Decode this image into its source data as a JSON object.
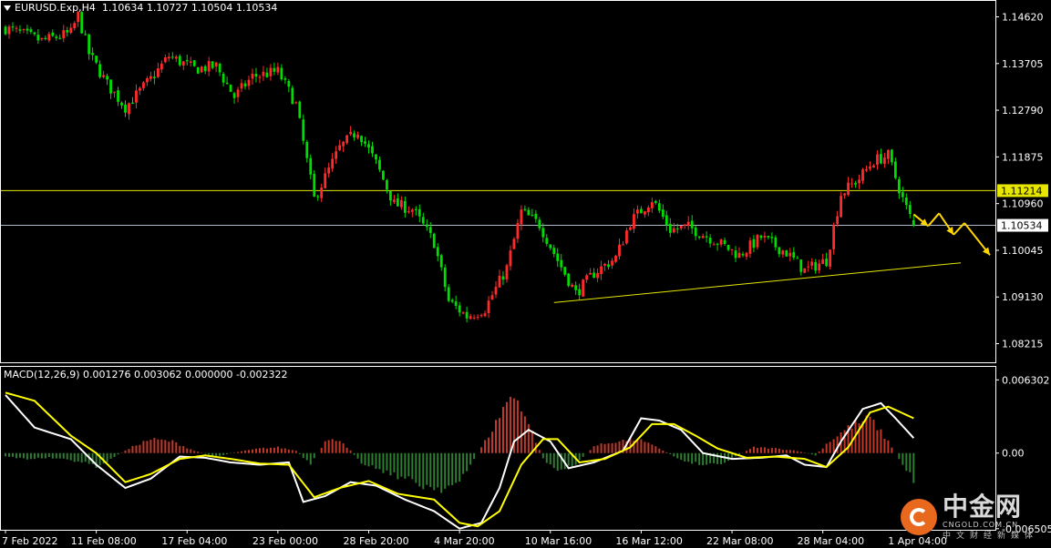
{
  "header": {
    "symbol": "EURUSD.Exp,H4",
    "open": "1.10634",
    "high": "1.10727",
    "low": "1.10504",
    "close": "1.10534"
  },
  "macd_header": {
    "label": "MACD(12,26,9)",
    "values": "0.001276 0.003062 0.000000 -0.002322"
  },
  "watermark": {
    "name": "中金网",
    "domain": "CNGOLD.COM.CN",
    "subtitle": "中文财经新媒体"
  },
  "colors": {
    "bull": "#ff2a2a",
    "bear": "#00dd00",
    "horizontal_line": "#e6e600",
    "current_price_line": "#b0b8c8",
    "trendline": "#e6e600",
    "signal_line": "#ffff00",
    "macd_line": "#ffffff",
    "hist_pos": "#c0392b",
    "hist_neg": "#2e7d32",
    "arrow": "#ffd700",
    "axis": "#ffffff"
  },
  "chart_data": [
    {
      "type": "candlestick",
      "title": "EURUSD.Exp,H4",
      "ylim": [
        1.0785,
        1.1495
      ],
      "y_ticks": [
        "1.14620",
        "1.13705",
        "1.12790",
        "1.11875",
        "1.10960",
        "1.10045",
        "1.09130",
        "1.08215"
      ],
      "price_labels": [
        {
          "value": 1.11214,
          "text": "1.11214",
          "style": "resistance"
        },
        {
          "value": 1.10534,
          "text": "1.10534",
          "style": "current"
        }
      ],
      "x_labels": [
        "7 Feb 2022",
        "11 Feb 08:00",
        "17 Feb 04:00",
        "23 Feb 00:00",
        "28 Feb 20:00",
        "4 Mar 20:00",
        "10 Mar 16:00",
        "16 Mar 12:00",
        "22 Mar 08:00",
        "28 Mar 04:00",
        "1 Apr 04:00"
      ],
      "x_label_index": [
        0,
        25,
        50,
        75,
        100,
        125,
        150,
        175,
        200,
        225,
        250
      ],
      "bar_count": 263,
      "close_path": [
        [
          0,
          1.144
        ],
        [
          10,
          1.1415
        ],
        [
          18,
          1.143
        ],
        [
          20,
          1.1465
        ],
        [
          23,
          1.139
        ],
        [
          28,
          1.133
        ],
        [
          33,
          1.1285
        ],
        [
          40,
          1.134
        ],
        [
          45,
          1.1385
        ],
        [
          52,
          1.136
        ],
        [
          58,
          1.1365
        ],
        [
          63,
          1.1305
        ],
        [
          68,
          1.1345
        ],
        [
          75,
          1.1355
        ],
        [
          80,
          1.129
        ],
        [
          85,
          1.1105
        ],
        [
          92,
          1.1205
        ],
        [
          97,
          1.124
        ],
        [
          102,
          1.1175
        ],
        [
          107,
          1.1095
        ],
        [
          112,
          1.1085
        ],
        [
          118,
          1.102
        ],
        [
          122,
          1.0905
        ],
        [
          127,
          1.0875
        ],
        [
          132,
          1.089
        ],
        [
          138,
          1.097
        ],
        [
          142,
          1.108
        ],
        [
          147,
          1.1055
        ],
        [
          152,
          1.0985
        ],
        [
          157,
          1.092
        ],
        [
          162,
          1.096
        ],
        [
          168,
          1.099
        ],
        [
          172,
          1.106
        ],
        [
          178,
          1.1105
        ],
        [
          183,
          1.1045
        ],
        [
          188,
          1.105
        ],
        [
          195,
          1.1025
        ],
        [
          202,
          1.0995
        ],
        [
          208,
          1.103
        ],
        [
          215,
          1.1
        ],
        [
          220,
          1.0965
        ],
        [
          226,
          1.0985
        ],
        [
          230,
          1.1115
        ],
        [
          235,
          1.1145
        ],
        [
          239,
          1.118
        ],
        [
          243,
          1.119
        ],
        [
          247,
          1.1105
        ],
        [
          250,
          1.1053
        ]
      ],
      "horizontal_lines": [
        1.11214,
        1.10534
      ],
      "trendline": {
        "from": [
          151,
          1.0902
        ],
        "to": [
          263,
          1.098
        ]
      },
      "projection_arrows": [
        [
          [
            250,
            1.1075
          ],
          [
            254,
            1.1052
          ]
        ],
        [
          [
            254,
            1.1052
          ],
          [
            257,
            1.1077
          ]
        ],
        [
          [
            257,
            1.1077
          ],
          [
            261,
            1.1035
          ]
        ],
        [
          [
            261,
            1.1035
          ],
          [
            264,
            1.1058
          ]
        ],
        [
          [
            264,
            1.1058
          ],
          [
            271,
            1.0995
          ]
        ]
      ]
    },
    {
      "type": "macd",
      "title": "MACD(12,26,9)",
      "values": {
        "macd": 0.001276,
        "signal": 0.003062,
        "extra": 0.0,
        "histogram": -0.002322
      },
      "ylim": [
        -0.0066,
        0.0075
      ],
      "y_ticks": [
        "0.006302",
        "0.00",
        "-0.006505"
      ],
      "macd_path": [
        [
          0,
          0.005
        ],
        [
          8,
          0.0022
        ],
        [
          18,
          0.0012
        ],
        [
          25,
          -0.001
        ],
        [
          33,
          -0.003
        ],
        [
          40,
          -0.0022
        ],
        [
          48,
          -0.0003
        ],
        [
          55,
          -0.0004
        ],
        [
          62,
          -0.0008
        ],
        [
          70,
          -0.001
        ],
        [
          78,
          -0.0008
        ],
        [
          82,
          -0.0042
        ],
        [
          88,
          -0.0037
        ],
        [
          95,
          -0.0025
        ],
        [
          102,
          -0.0028
        ],
        [
          110,
          -0.004
        ],
        [
          118,
          -0.005
        ],
        [
          125,
          -0.0065
        ],
        [
          131,
          -0.006
        ],
        [
          136,
          -0.003
        ],
        [
          140,
          0.001
        ],
        [
          144,
          0.002
        ],
        [
          150,
          0.001
        ],
        [
          155,
          -0.0013
        ],
        [
          162,
          -0.0008
        ],
        [
          170,
          0.0002
        ],
        [
          175,
          0.003
        ],
        [
          180,
          0.0028
        ],
        [
          186,
          0.002
        ],
        [
          192,
          0.0
        ],
        [
          200,
          -0.0005
        ],
        [
          208,
          -0.0004
        ],
        [
          215,
          -0.0002
        ],
        [
          220,
          -0.001
        ],
        [
          226,
          -0.0012
        ],
        [
          230,
          0.001
        ],
        [
          236,
          0.0038
        ],
        [
          241,
          0.0043
        ],
        [
          245,
          0.003
        ],
        [
          250,
          0.0013
        ]
      ],
      "signal_path": [
        [
          0,
          0.0052
        ],
        [
          8,
          0.0045
        ],
        [
          18,
          0.0015
        ],
        [
          25,
          0.0
        ],
        [
          33,
          -0.0025
        ],
        [
          40,
          -0.0018
        ],
        [
          48,
          -0.0005
        ],
        [
          55,
          -0.0002
        ],
        [
          62,
          -0.0005
        ],
        [
          70,
          -0.0009
        ],
        [
          78,
          -0.001
        ],
        [
          85,
          -0.0038
        ],
        [
          92,
          -0.003
        ],
        [
          100,
          -0.0024
        ],
        [
          108,
          -0.0035
        ],
        [
          118,
          -0.004
        ],
        [
          125,
          -0.006
        ],
        [
          130,
          -0.0063
        ],
        [
          136,
          -0.005
        ],
        [
          142,
          -0.001
        ],
        [
          148,
          0.0012
        ],
        [
          152,
          0.0012
        ],
        [
          158,
          -0.0008
        ],
        [
          165,
          -0.0005
        ],
        [
          172,
          0.0005
        ],
        [
          178,
          0.0025
        ],
        [
          184,
          0.0025
        ],
        [
          190,
          0.0015
        ],
        [
          196,
          0.0004
        ],
        [
          204,
          -0.0004
        ],
        [
          212,
          -0.0003
        ],
        [
          220,
          -0.0005
        ],
        [
          226,
          -0.0012
        ],
        [
          232,
          0.0005
        ],
        [
          238,
          0.0035
        ],
        [
          243,
          0.004
        ],
        [
          250,
          0.003
        ]
      ],
      "histogram_path": [
        [
          0,
          -0.0003
        ],
        [
          6,
          -0.0005
        ],
        [
          12,
          -0.0004
        ],
        [
          20,
          -0.0007
        ],
        [
          26,
          -0.0012
        ],
        [
          30,
          -0.0003
        ],
        [
          36,
          0.0007
        ],
        [
          40,
          0.0012
        ],
        [
          46,
          0.001
        ],
        [
          52,
          0.0002
        ],
        [
          58,
          -0.0003
        ],
        [
          64,
          0.0001
        ],
        [
          70,
          0.0004
        ],
        [
          75,
          0.0005
        ],
        [
          80,
          0.0002
        ],
        [
          84,
          -0.001
        ],
        [
          88,
          0.001
        ],
        [
          92,
          0.0012
        ],
        [
          98,
          -0.0008
        ],
        [
          104,
          -0.0015
        ],
        [
          110,
          -0.0022
        ],
        [
          115,
          -0.0028
        ],
        [
          120,
          -0.003
        ],
        [
          125,
          -0.0026
        ],
        [
          130,
          0.0
        ],
        [
          134,
          0.002
        ],
        [
          138,
          0.0045
        ],
        [
          141,
          0.0048
        ],
        [
          144,
          0.0025
        ],
        [
          148,
          -0.0005
        ],
        [
          152,
          -0.0015
        ],
        [
          156,
          -0.0012
        ],
        [
          162,
          0.0006
        ],
        [
          168,
          0.001
        ],
        [
          174,
          0.0012
        ],
        [
          180,
          0.0004
        ],
        [
          186,
          -0.0006
        ],
        [
          192,
          -0.001
        ],
        [
          198,
          -0.0008
        ],
        [
          206,
          0.0005
        ],
        [
          212,
          0.0004
        ],
        [
          218,
          0.0002
        ],
        [
          223,
          -0.0002
        ],
        [
          226,
          0.0008
        ],
        [
          232,
          0.0022
        ],
        [
          238,
          0.003
        ],
        [
          243,
          0.001
        ],
        [
          247,
          -0.001
        ],
        [
          250,
          -0.0023
        ]
      ]
    }
  ]
}
